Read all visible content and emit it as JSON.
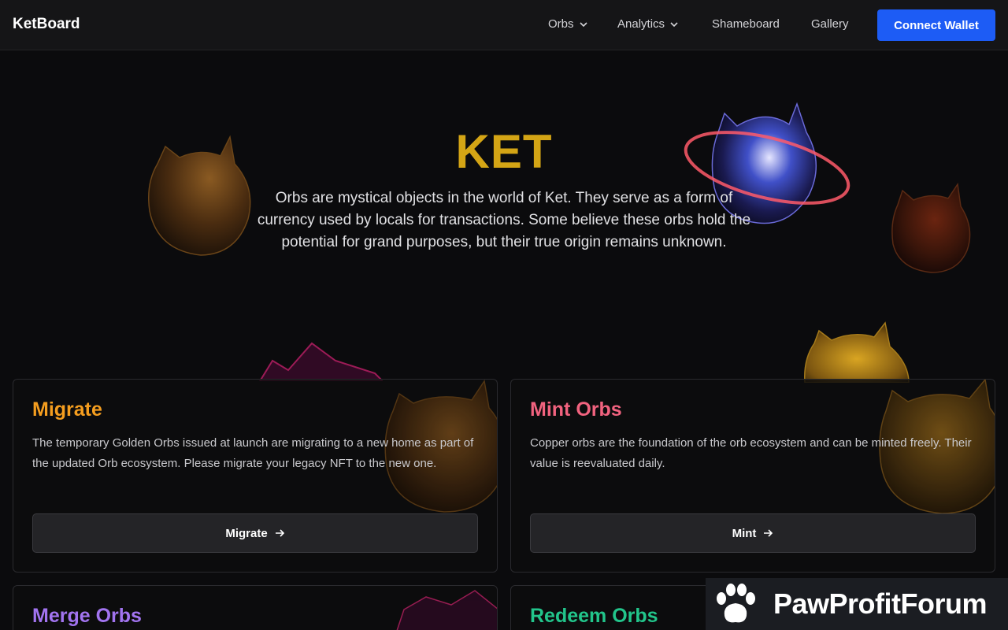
{
  "nav": {
    "brand": "KetBoard",
    "items": [
      {
        "label": "Orbs",
        "dropdown": true
      },
      {
        "label": "Analytics",
        "dropdown": true
      },
      {
        "label": "Shameboard",
        "dropdown": false
      },
      {
        "label": "Gallery",
        "dropdown": false
      }
    ],
    "connect_label": "Connect Wallet"
  },
  "hero": {
    "title": "KET",
    "description": "Orbs are mystical objects in the world of Ket. They serve as a form of currency used by locals for transactions. Some believe these orbs hold the potential for grand purposes, but their true origin remains unknown."
  },
  "cards": [
    {
      "title": "Migrate",
      "title_color": "#f59e1f",
      "description": "The temporary Golden Orbs issued at launch are migrating to a new home as part of the updated Orb ecosystem. Please migrate your legacy NFT to the new one.",
      "button_label": "Migrate"
    },
    {
      "title": "Mint Orbs",
      "title_color": "#f2637f",
      "description": "Copper orbs are the foundation of the orb ecosystem and can be minted freely. Their value is reevaluated daily.",
      "button_label": "Mint"
    },
    {
      "title": "Merge Orbs",
      "title_color": "#a274f0"
    },
    {
      "title": "Redeem Orbs",
      "title_color": "#22c58b"
    }
  ],
  "watermark": {
    "text": "PawProfitForum"
  },
  "colors": {
    "accent": "#1d5cf5",
    "hero_title": "#d4a515",
    "background": "#0b0b0d"
  }
}
